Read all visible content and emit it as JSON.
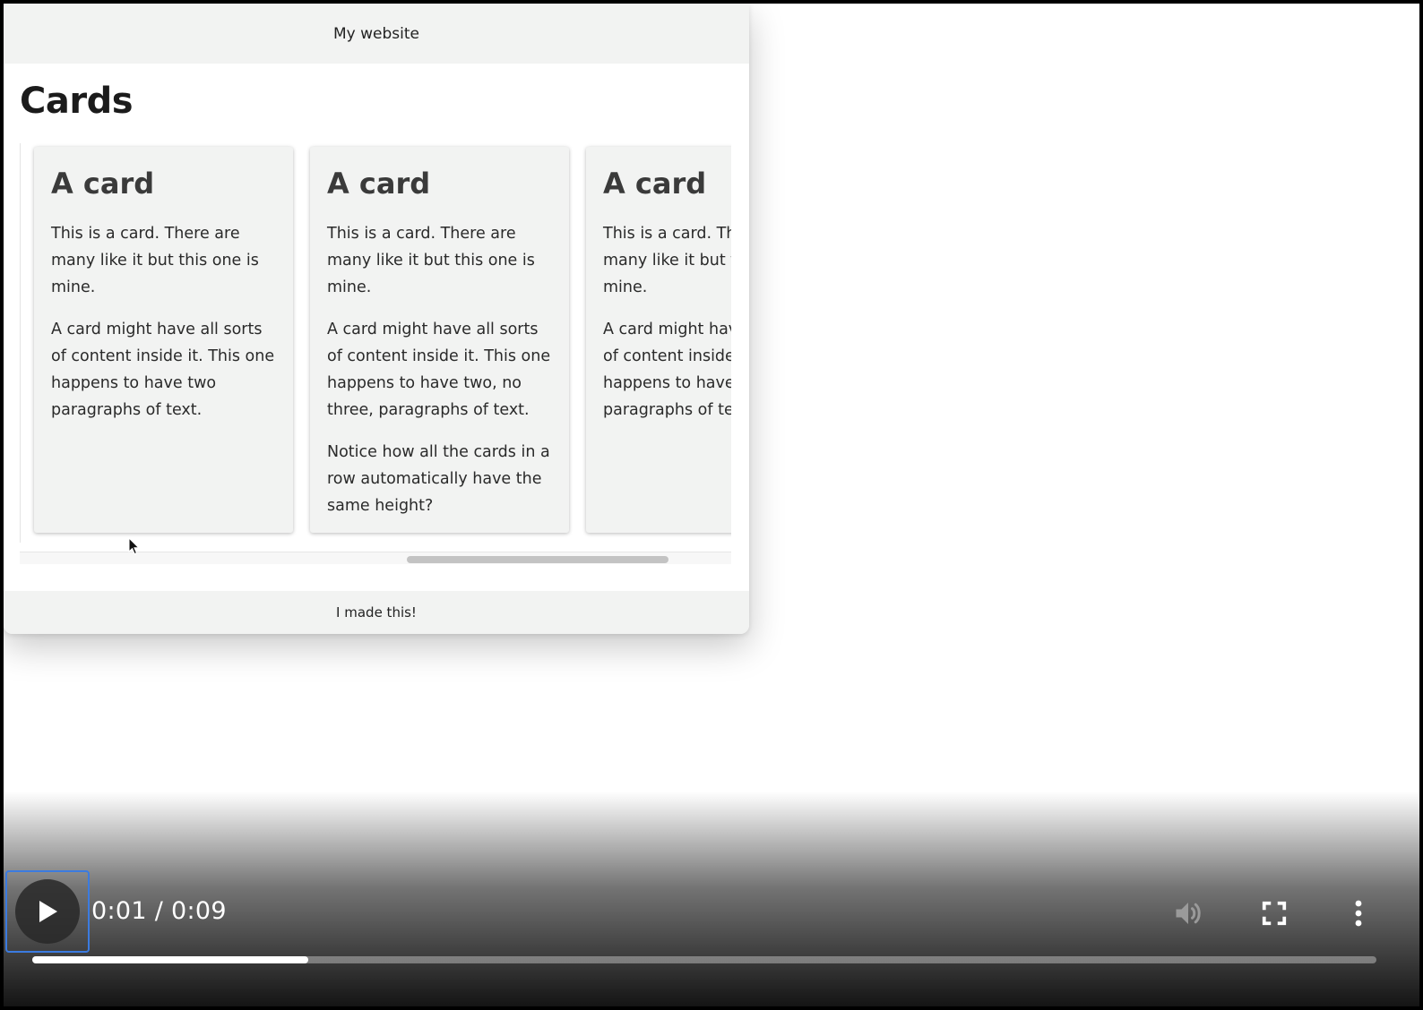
{
  "site": {
    "header_title": "My website",
    "heading": "Cards",
    "footer_text": "I made this!",
    "cards": [
      {
        "title": "A card",
        "paragraphs": [
          "This is a card. There are many like it but this one is mine.",
          "A card might have all sorts of content inside it. This one happens to have two paragraphs of text."
        ]
      },
      {
        "title": "A card",
        "paragraphs": [
          "This is a card. There are many like it but this one is mine.",
          "A card might have all sorts of content inside it. This one happens to have two, no three, paragraphs of text.",
          "Notice how all the cards in a row automatically have the same height?"
        ]
      },
      {
        "title": "A card",
        "paragraphs": [
          "This is a card. There are many like it but this one is mine.",
          "A card might have all sorts of content inside it. This one happens to have two paragraphs of text."
        ]
      }
    ]
  },
  "player": {
    "time_display": "0:01 / 0:09",
    "progress_fraction": 0.205,
    "icons": {
      "play": "play-icon",
      "volume": "volume-icon",
      "fullscreen": "fullscreen-icon",
      "more": "more-options-icon"
    },
    "colors": {
      "focus_ring": "#3b7be0",
      "progress_fill": "#ffffff",
      "progress_track": "rgba(255,255,255,0.35)",
      "volume_icon": "#9a9a9a"
    }
  }
}
